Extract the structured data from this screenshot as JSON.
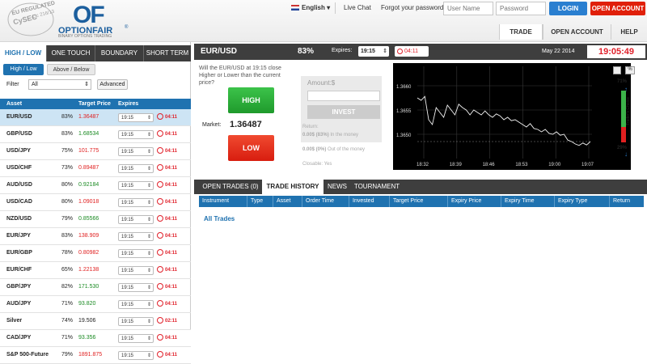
{
  "header": {
    "badge_line1": "EU REGULATED",
    "badge_line2": "CySEC",
    "badge_line3": "Lic 216/13",
    "logo_big": "OF",
    "logo_name": "OPTIONFAIR",
    "logo_reg": "®",
    "logo_tagline": "BINARY OPTIONS TRADING",
    "language": "English",
    "live_chat": "Live Chat",
    "forgot": "Forgot your password?",
    "username_placeholder": "User Name",
    "password_placeholder": "Password",
    "login": "LOGIN",
    "open_account": "OPEN ACCOUNT"
  },
  "nav": {
    "tabs": [
      "TRADE",
      "OPEN ACCOUNT",
      "HELP"
    ]
  },
  "option_types": [
    "HIGH / LOW",
    "ONE TOUCH",
    "BOUNDARY",
    "SHORT TERM"
  ],
  "sub_types": [
    "High / Low",
    "Above / Below"
  ],
  "filter": {
    "label": "Filter",
    "value": "All",
    "advanced": "Advanced"
  },
  "table": {
    "headers": [
      "Asset",
      "Target Price",
      "Expires"
    ],
    "rows": [
      {
        "asset": "EUR/USD",
        "pct": "83%",
        "price": "1.36487",
        "dir": "down",
        "expires": "19:15",
        "time": "04:11"
      },
      {
        "asset": "GBP/USD",
        "pct": "83%",
        "price": "1.68534",
        "dir": "up",
        "expires": "19:15",
        "time": "04:11"
      },
      {
        "asset": "USD/JPY",
        "pct": "75%",
        "price": "101.775",
        "dir": "down",
        "expires": "19:15",
        "time": "04:11"
      },
      {
        "asset": "USD/CHF",
        "pct": "73%",
        "price": "0.89487",
        "dir": "down",
        "expires": "19:15",
        "time": "04:11"
      },
      {
        "asset": "AUD/USD",
        "pct": "80%",
        "price": "0.92184",
        "dir": "up",
        "expires": "19:15",
        "time": "04:11"
      },
      {
        "asset": "USD/CAD",
        "pct": "80%",
        "price": "1.09018",
        "dir": "down",
        "expires": "19:15",
        "time": "04:11"
      },
      {
        "asset": "NZD/USD",
        "pct": "79%",
        "price": "0.85566",
        "dir": "up",
        "expires": "19:15",
        "time": "04:11"
      },
      {
        "asset": "EUR/JPY",
        "pct": "83%",
        "price": "138.909",
        "dir": "down",
        "expires": "19:15",
        "time": "04:11"
      },
      {
        "asset": "EUR/GBP",
        "pct": "78%",
        "price": "0.80982",
        "dir": "down",
        "expires": "19:15",
        "time": "04:11"
      },
      {
        "asset": "EUR/CHF",
        "pct": "65%",
        "price": "1.22138",
        "dir": "down",
        "expires": "19:15",
        "time": "04:11"
      },
      {
        "asset": "GBP/JPY",
        "pct": "82%",
        "price": "171.530",
        "dir": "up",
        "expires": "19:15",
        "time": "04:11"
      },
      {
        "asset": "AUD/JPY",
        "pct": "71%",
        "price": "93.820",
        "dir": "up",
        "expires": "19:15",
        "time": "04:11"
      },
      {
        "asset": "Silver",
        "pct": "74%",
        "price": "19.506",
        "dir": "neutral",
        "expires": "19:15",
        "time": "02:11"
      },
      {
        "asset": "CAD/JPY",
        "pct": "71%",
        "price": "93.356",
        "dir": "up",
        "expires": "19:15",
        "time": "04:11"
      },
      {
        "asset": "S&P 500-Future",
        "pct": "79%",
        "price": "1891.875",
        "dir": "down",
        "expires": "19:15",
        "time": "04:11"
      }
    ]
  },
  "trade": {
    "asset": "EUR/USD",
    "payout": "83%",
    "expires_label": "Expires:",
    "expires_value": "19:15",
    "countdown": "04:11",
    "date": "May 22 2014",
    "clock": "19:05:49",
    "question": "Will the EUR/USD at 19:15 close Higher or Lower than the current price?",
    "high": "HIGH",
    "low": "LOW",
    "market_label": "Market:",
    "market_value": "1.36487",
    "amount_placeholder": "Amount:$",
    "invest": "INVEST",
    "return_label": "Return:",
    "in_money_amount": "0.00$ (83%)",
    "in_money_label": " In the money",
    "out_money_amount": "0.00$ (0%)",
    "out_money_label": " Out of the money",
    "closable": "Closable: Yes"
  },
  "chart_data": {
    "type": "line",
    "x_ticks": [
      "18:32",
      "18:39",
      "18:46",
      "18:53",
      "19:00",
      "19:07"
    ],
    "y_ticks": [
      "1.3660",
      "1.3655",
      "1.3650"
    ],
    "ylim": [
      1.3645,
      1.3664
    ],
    "y": [
      1.36575,
      1.3657,
      1.36578,
      1.3653,
      1.3652,
      1.36555,
      1.36545,
      1.36535,
      1.3656,
      1.3655,
      1.3654,
      1.36562,
      1.36555,
      1.3655,
      1.3654,
      1.3655,
      1.36545,
      1.3654,
      1.36548,
      1.3654,
      1.36535,
      1.36542,
      1.36538,
      1.3653,
      1.36535,
      1.36528,
      1.3653,
      1.36525,
      1.3652,
      1.36515,
      1.36522,
      1.36512,
      1.3651,
      1.36505,
      1.3651,
      1.36502,
      1.365,
      1.36505,
      1.36498,
      1.365,
      1.36488,
      1.36485,
      1.3648,
      1.36477,
      1.36482,
      1.36478,
      1.36485
    ],
    "traders_choice": {
      "title": "Trader's Choice",
      "up_pct": "71%",
      "down_pct": "29%",
      "up": 0.71,
      "down": 0.29
    }
  },
  "positions": {
    "tabs": [
      "OPEN TRADES (0)",
      "TRADE HISTORY",
      "NEWS",
      "TOURNAMENT"
    ],
    "headers": [
      "Instrument",
      "Type",
      "Asset",
      "Order Time",
      "Invested",
      "Target Price",
      "Expiry Price",
      "Expiry Time",
      "Expiry Type",
      "Return"
    ],
    "all_trades": "All Trades"
  },
  "colors": {
    "accent": "#1f72b0",
    "up": "#1a8a22",
    "down": "#e02020",
    "login": "#2a7fd0",
    "open_account": "#e0200a"
  }
}
